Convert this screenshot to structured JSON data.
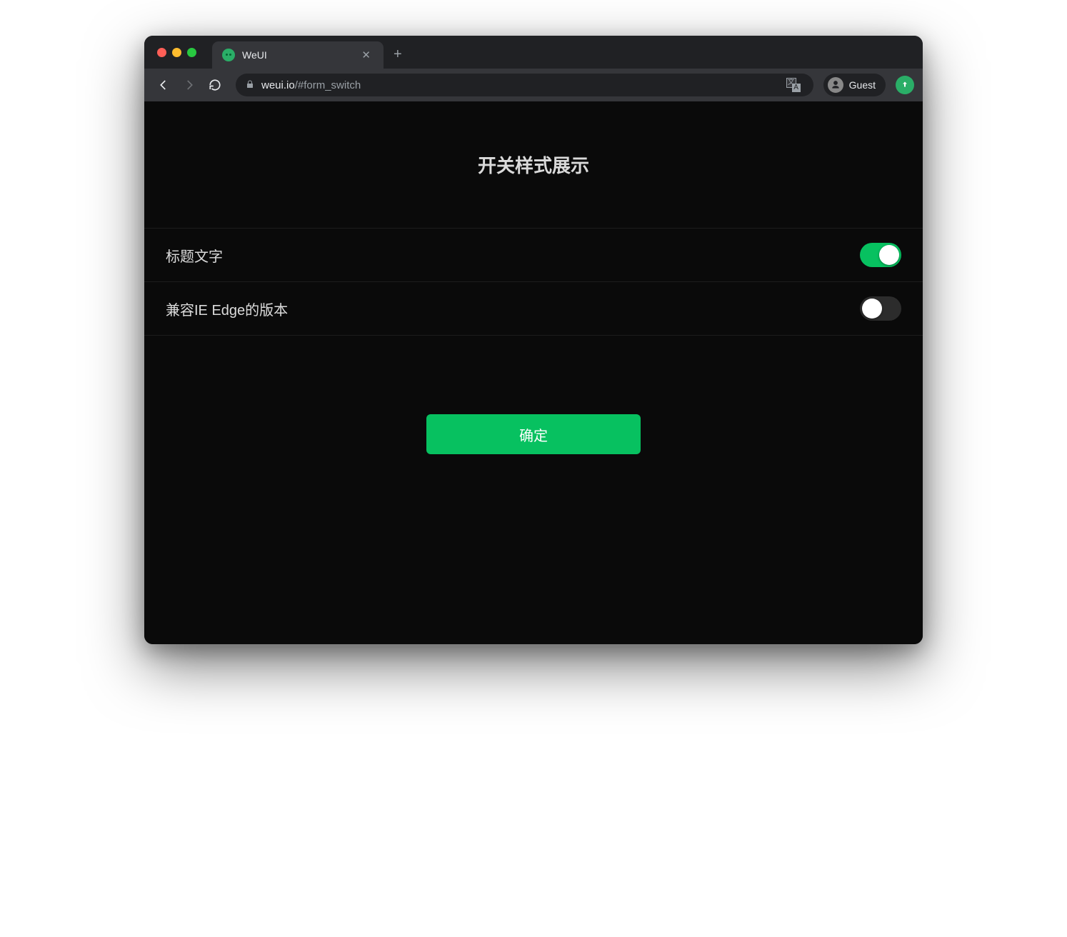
{
  "browser": {
    "tab_title": "WeUI",
    "url_host": "weui.io",
    "url_path": "/#form_switch",
    "guest_label": "Guest"
  },
  "page": {
    "title": "开关样式展示",
    "cells": [
      {
        "label": "标题文字",
        "checked": true
      },
      {
        "label": "兼容IE Edge的版本",
        "checked": false
      }
    ],
    "submit_label": "确定"
  },
  "colors": {
    "accent": "#07c160",
    "bg": "#0a0a0a"
  }
}
